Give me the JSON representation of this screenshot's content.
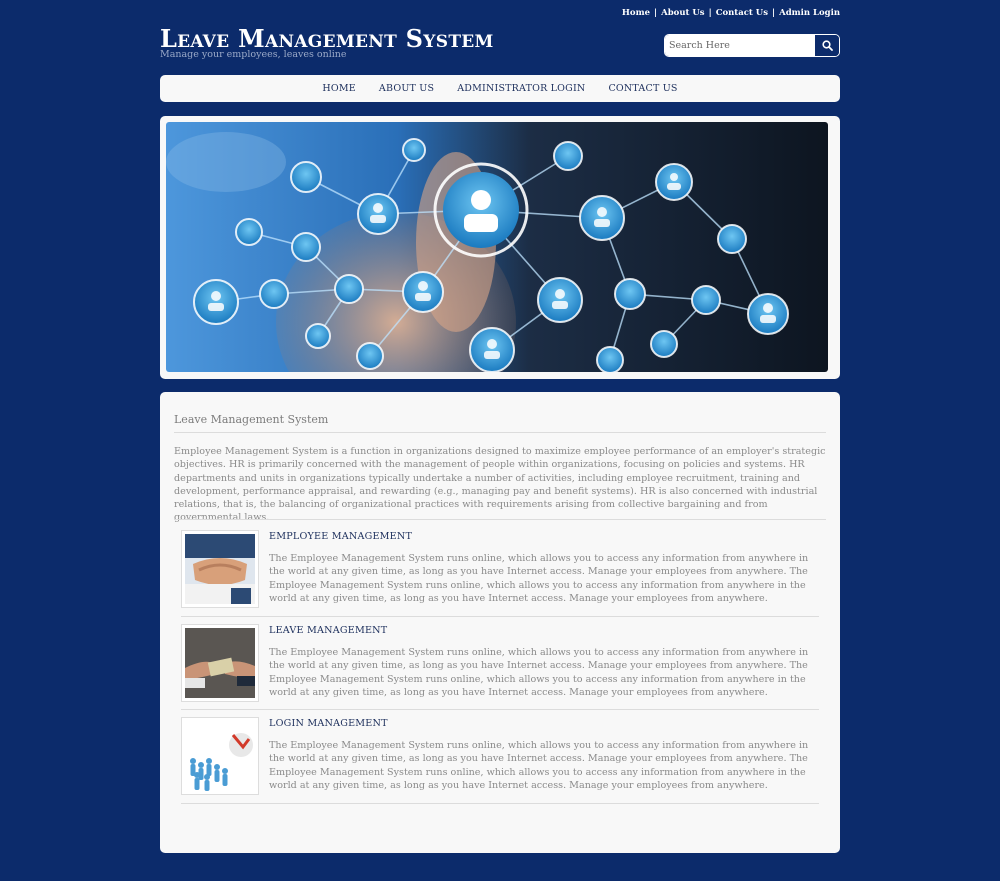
{
  "toplinks": [
    {
      "label": "Home"
    },
    {
      "label": "About Us"
    },
    {
      "label": "Contact Us"
    },
    {
      "label": "Admin Login"
    }
  ],
  "logo": {
    "title": "Leave Management System",
    "subtitle": "Manage your employees, leaves online"
  },
  "search": {
    "placeholder": "Search Here",
    "icon": "search-icon"
  },
  "nav": [
    {
      "label": "HOME"
    },
    {
      "label": "ABOUT US"
    },
    {
      "label": "ADMINISTRATOR LOGIN"
    },
    {
      "label": "CONTACT US"
    }
  ],
  "content": {
    "title": "Leave Management System",
    "intro": "Employee Management System is a function in organizations designed to maximize employee performance of an employer's strategic objectives. HR is primarily concerned with the management of people within organizations, focusing on policies and systems. HR departments and units in organizations typically undertake a number of activities, including employee recruitment, training and development, performance appraisal, and rewarding (e.g., managing pay and benefit systems). HR is also concerned with industrial relations, that is, the balancing of organizational practices with requirements arising from collective bargaining and from governmental laws.",
    "items": [
      {
        "title": "EMPLOYEE MANAGEMENT",
        "text": "The Employee Management System runs online, which allows you to access any information from anywhere in the world at any given time, as long as you have Internet access. Manage your employees from anywhere. The Employee Management System runs online, which allows you to access any information from anywhere in the world at any given time, as long as you have Internet access. Manage your employees from anywhere."
      },
      {
        "title": "LEAVE MANAGEMENT",
        "text": "The Employee Management System runs online, which allows you to access any information from anywhere in the world at any given time, as long as you have Internet access. Manage your employees from anywhere. The Employee Management System runs online, which allows you to access any information from anywhere in the world at any given time, as long as you have Internet access. Manage your employees from anywhere."
      },
      {
        "title": "LOGIN MANAGEMENT",
        "text": "The Employee Management System runs online, which allows you to access any information from anywhere in the world at any given time, as long as you have Internet access. Manage your employees from anywhere. The Employee Management System runs online, which allows you to access any information from anywhere in the world at any given time, as long as you have Internet access. Manage your employees from anywhere."
      }
    ]
  },
  "colors": {
    "background": "#0c2b6b",
    "panel": "#f8f8f8",
    "heading": "#1d2f5c",
    "body_text": "#8a8a8a"
  }
}
